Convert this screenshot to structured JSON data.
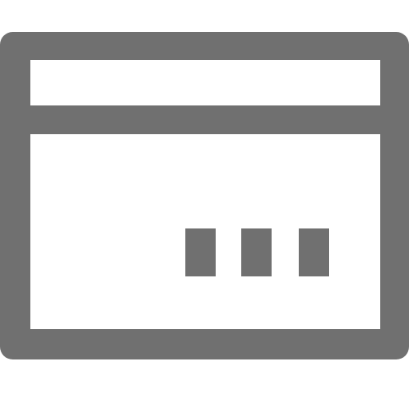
{
  "icon": {
    "name": "browser-window-icon",
    "color": "#707070",
    "background": "#ffffff"
  },
  "window": {
    "parts": [
      "title-bar",
      "content-area"
    ]
  },
  "indicators": {
    "count": 3,
    "icon": "ellipsis-icon"
  }
}
